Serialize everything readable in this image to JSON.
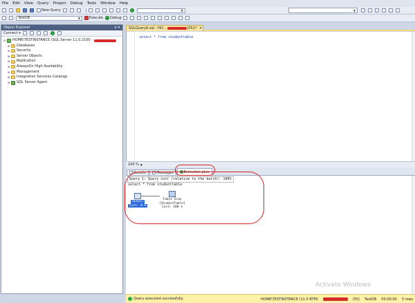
{
  "menu": [
    "File",
    "Edit",
    "View",
    "Query",
    "Project",
    "Debug",
    "Tools",
    "Window",
    "Help"
  ],
  "toolbar1": {
    "new_query_label": "New Query"
  },
  "toolbar2": {
    "database_value": "TestDB",
    "execute_label": "Execute",
    "debug_label": "Debug"
  },
  "object_explorer": {
    "title": "Object Explorer",
    "title_pin": "▾ ✕",
    "connect_label": "Connect ▾",
    "server": "HOME\\TESTINSTANCE (SQL Server 11.0.2100 - ",
    "nodes": [
      "Databases",
      "Security",
      "Server Objects",
      "Replication",
      "AlwaysOn High Availability",
      "Management",
      "Integration Services Catalogs",
      "SQL Server Agent"
    ]
  },
  "editor": {
    "tab_label": "SQLQuery6.sql - HO...",
    "tab_suffix": "(55))*",
    "tab_close": "✕",
    "code": "select * from studenttable",
    "zoom": "100 %"
  },
  "results": {
    "tabs": [
      "Results",
      "Messages",
      "Execution plan"
    ],
    "query_line": "Query 1: Query cost (relative to the batch): 100%",
    "query_text": "select * from studenttable",
    "select_op": {
      "name": "SELECT",
      "cost": "Cost: 0 %"
    },
    "scan_op": {
      "name": "Table Scan",
      "table": "[StudentTable]",
      "cost": "Cost: 100 %"
    }
  },
  "status": {
    "message": "Query executed successfully.",
    "instance": "HOME\\TESTINSTANCE (11.0 RTM)",
    "user_suffix": "(55)",
    "database": "TestDB",
    "time": "00:00:00",
    "rows": "3 rows"
  },
  "watermark": "Activate Windows",
  "colors": {
    "annotation": "#d62222",
    "status_bar": "#fff1a8",
    "tab_active": "#f6e6a2"
  }
}
